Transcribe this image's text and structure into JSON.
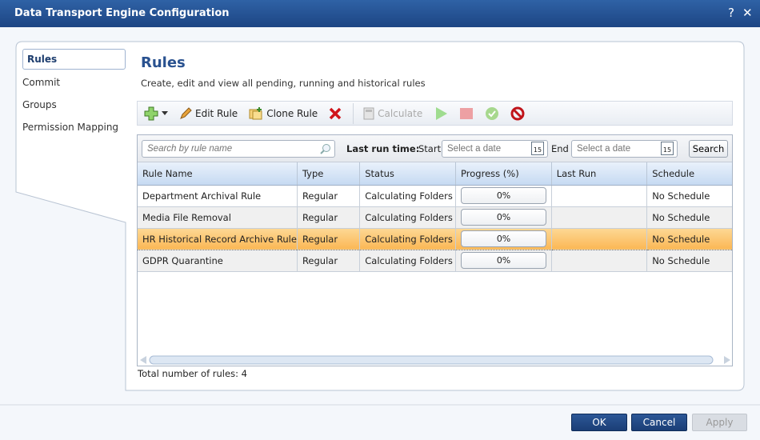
{
  "window": {
    "title": "Data Transport Engine Configuration",
    "help": "?",
    "close": "✕"
  },
  "sidebar": {
    "items": [
      {
        "label": "Rules"
      },
      {
        "label": "Commit"
      },
      {
        "label": "Groups"
      },
      {
        "label": "Permission Mapping"
      }
    ]
  },
  "main": {
    "title": "Rules",
    "subtitle": "Create, edit and view all pending, running and historical rules"
  },
  "toolbar": {
    "edit": "Edit Rule",
    "clone": "Clone Rule",
    "calculate": "Calculate"
  },
  "filter": {
    "search_placeholder": "Search by rule name",
    "last_run": "Last run time:",
    "start": "Start",
    "end": "End",
    "date_placeholder": "Select a date",
    "calendar_day": "15",
    "search_button": "Search"
  },
  "table": {
    "columns": [
      "Rule Name",
      "Type",
      "Status",
      "Progress (%)",
      "Last Run",
      "Schedule"
    ],
    "rows": [
      {
        "name": "Department Archival Rule",
        "type": "Regular",
        "status": "Calculating Folders",
        "progress": "0%",
        "last_run": "",
        "schedule": "No Schedule"
      },
      {
        "name": "Media File Removal",
        "type": "Regular",
        "status": "Calculating Folders",
        "progress": "0%",
        "last_run": "",
        "schedule": "No Schedule"
      },
      {
        "name": "HR Historical Record Archive Rule",
        "type": "Regular",
        "status": "Calculating Folders",
        "progress": "0%",
        "last_run": "",
        "schedule": "No Schedule"
      },
      {
        "name": "GDPR Quarantine",
        "type": "Regular",
        "status": "Calculating Folders",
        "progress": "0%",
        "last_run": "",
        "schedule": "No Schedule"
      }
    ]
  },
  "footer": {
    "total": "Total number of rules: 4",
    "ok": "OK",
    "cancel": "Cancel",
    "apply": "Apply"
  }
}
